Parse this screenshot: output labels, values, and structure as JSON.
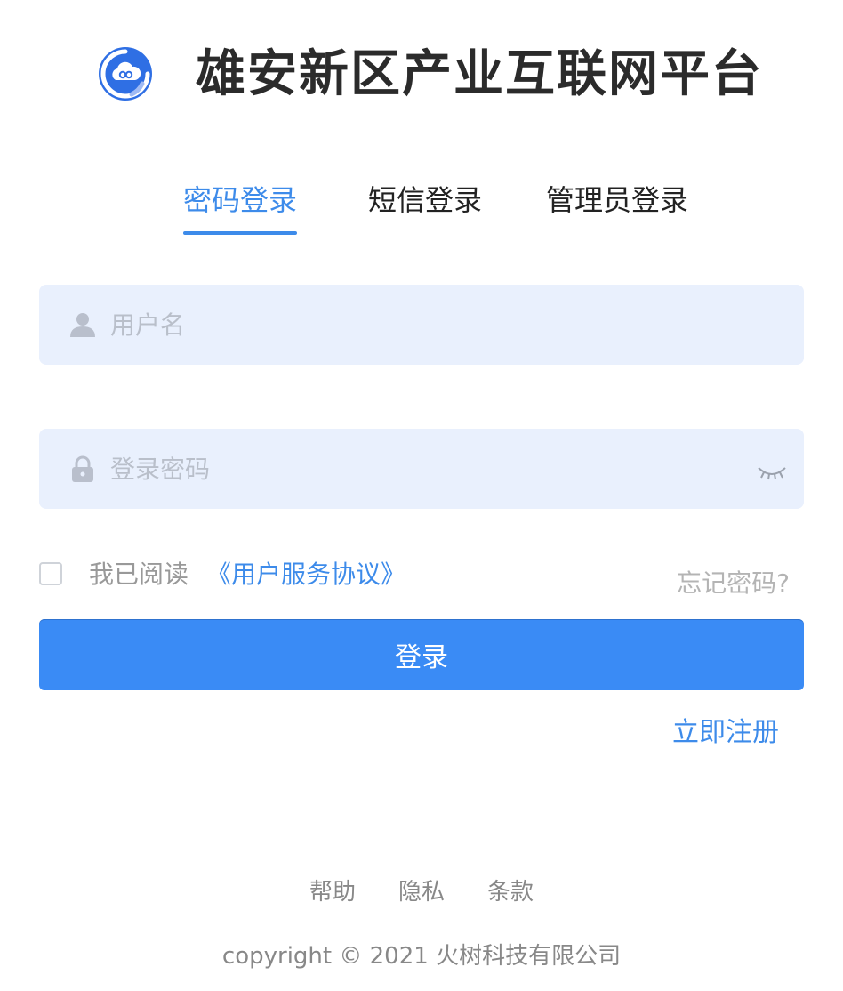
{
  "header": {
    "title": "雄安新区产业互联网平台",
    "logo_icon": "cloud-logo-icon",
    "logo_color": "#3d6fe0"
  },
  "tabs": [
    {
      "label": "密码登录",
      "active": true
    },
    {
      "label": "短信登录",
      "active": false
    },
    {
      "label": "管理员登录",
      "active": false
    }
  ],
  "form": {
    "username_placeholder": "用户名",
    "username_icon": "user-icon",
    "password_placeholder": "登录密码",
    "password_icon": "lock-icon",
    "password_toggle_icon": "eye-closed-icon",
    "agree_text": "我已阅读",
    "agreement_link": "《用户服务协议》",
    "forgot_label": "忘记密码?",
    "login_label": "登录",
    "register_label": "立即注册"
  },
  "footer": {
    "links": [
      "帮助",
      "隐私",
      "条款"
    ],
    "copyright": "copyright © 2021 火树科技有限公司"
  },
  "colors": {
    "accent": "#3d8bea",
    "button": "#3a8bf5",
    "field_bg": "#e9f0fd"
  }
}
